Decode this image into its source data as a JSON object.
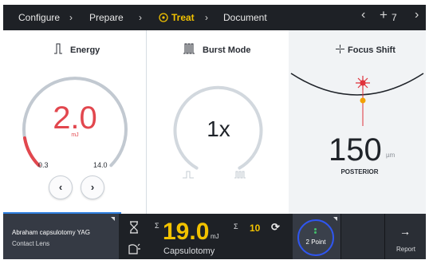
{
  "nav": {
    "steps": [
      {
        "label": "Configure"
      },
      {
        "label": "Prepare"
      },
      {
        "label": "Treat",
        "active": true
      },
      {
        "label": "Document"
      }
    ],
    "separator": "›",
    "prev_glyph": "‹",
    "add_glyph": "+",
    "add_count": "7",
    "next_glyph": "›"
  },
  "energy": {
    "title": "Energy",
    "value": "2.0",
    "unit": "mJ",
    "min": "0.3",
    "max": "14.0",
    "level_fraction": 0.13,
    "decrease_glyph": "‹",
    "increase_glyph": "›",
    "accent_color": "#e2474e"
  },
  "burst": {
    "title": "Burst Mode",
    "value": "1x"
  },
  "focus": {
    "title": "Focus Shift",
    "value": "150",
    "unit": "µm",
    "direction": "POSTERIOR"
  },
  "status": {
    "patient_line1": "Abraham capsulotomy YAG",
    "patient_line2": "Contact Lens",
    "sigma": "Σ",
    "total_energy": "19.0",
    "energy_unit": "mJ",
    "pulse_count": "10",
    "reset_glyph": "⟳",
    "procedure": "Capsulotomy",
    "point_mode": "2 Point",
    "report_label": "Report",
    "report_glyph": "→"
  },
  "colors": {
    "accent_yellow": "#f2c200",
    "active_blue": "#2f7fe0",
    "bar_dark": "#1e2126",
    "laser_red": "#e0323b",
    "focus_orange": "#f2a100"
  },
  "icons": {
    "target": "target-icon",
    "energy": "energy-pulse-icon",
    "burst": "burst-mode-icon",
    "focus": "focus-shift-icon",
    "timer": "hourglass-icon",
    "contact_lens": "contact-lens-icon",
    "reset": "reset-icon",
    "report": "arrow-right-icon"
  }
}
